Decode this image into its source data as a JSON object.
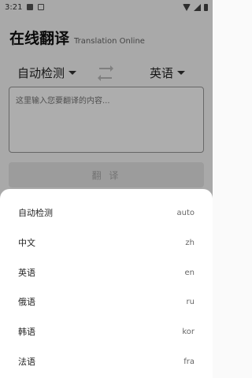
{
  "status_bar": {
    "time": "3:21"
  },
  "header": {
    "title": "在线翻译",
    "subtitle": "Translation Online"
  },
  "language_row": {
    "source": "自动检测",
    "target": "英语"
  },
  "input": {
    "placeholder": "这里输入您要翻译的内容..."
  },
  "translate_button": {
    "label": "翻 译"
  },
  "language_sheet": {
    "items": [
      {
        "name": "自动检测",
        "code": "auto"
      },
      {
        "name": "中文",
        "code": "zh"
      },
      {
        "name": "英语",
        "code": "en"
      },
      {
        "name": "俄语",
        "code": "ru"
      },
      {
        "name": "韩语",
        "code": "kor"
      },
      {
        "name": "法语",
        "code": "fra"
      }
    ]
  },
  "icons": {
    "swap": "swap-arrows-icon",
    "dropdown": "chevron-down-icon"
  }
}
